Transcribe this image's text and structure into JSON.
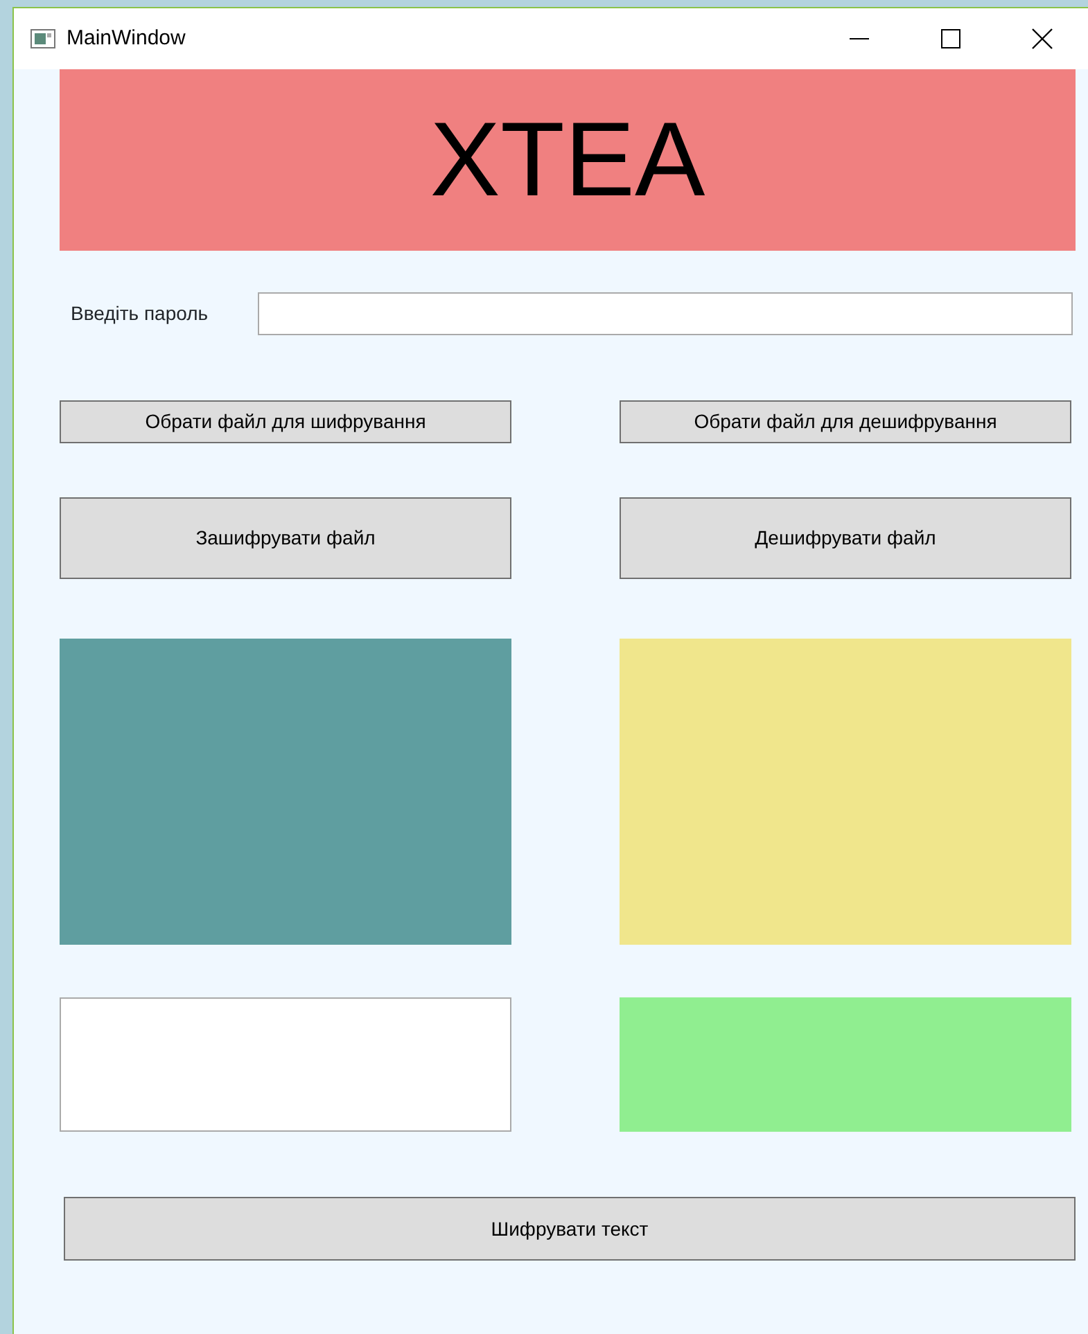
{
  "window": {
    "title": "MainWindow"
  },
  "banner": {
    "title": "XTEA",
    "color": "#f08080"
  },
  "password": {
    "label": "Введіть пароль"
  },
  "file_buttons": [
    "Обрати файл для шифрування",
    "Обрати файл для дешифрування"
  ],
  "action_buttons": [
    "Зашифрувати файл",
    "Дешифрувати файл"
  ],
  "panels": [
    {
      "kind": "block",
      "color": "#5f9ea0"
    },
    {
      "kind": "block",
      "color": "#f0e68c"
    },
    {
      "kind": "field",
      "color": "#ffffff"
    },
    {
      "kind": "block",
      "color": "#90ee90"
    }
  ],
  "bottom_button": "Шифрувати текст"
}
